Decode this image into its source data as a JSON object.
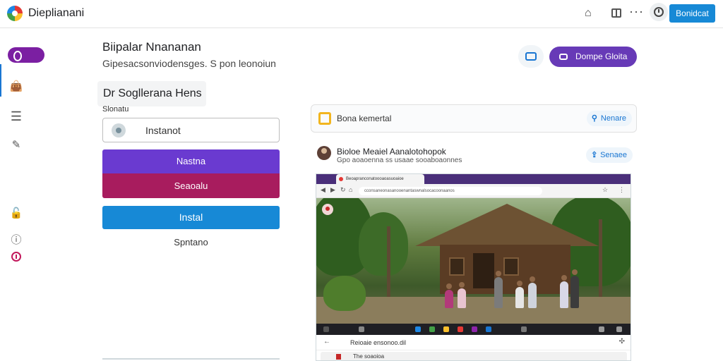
{
  "app": {
    "title": "Dieplianani"
  },
  "topbar": {
    "primary_label": "Bonidcat"
  },
  "header": {
    "title": "Biipalar Nnananan",
    "subtitle": "Gipesacsonviodensges. S pon leonoiun",
    "purple_button_label": "Dompe Gloita"
  },
  "form": {
    "section_heading": "Dr Sogllerana Hens",
    "field_label": "Slonatu",
    "field_value": "Instanot",
    "button_a_label": "Nastna",
    "button_b_label": "Seaoalu",
    "install_label": "Instal",
    "link_label": "Spntano"
  },
  "card1": {
    "label": "Bona kemertal",
    "button_label": "Nenare",
    "button_icon": "search-icon"
  },
  "post": {
    "title": "Bioloe Meaiel Aanalotohopok",
    "subtitle": "Gpo aoaoenna ss usaae sooaboaonnes",
    "button_label": "Senaee"
  },
  "browser": {
    "tab_title": "Beoapranconatoooaoasuoaioe",
    "url": "cconsaneonasanooenantaswnalsocacoonaanos",
    "lower_label": "Reioaie ensonoo.dil",
    "row_label": "The soaoioa"
  },
  "colors": {
    "accent_blue": "#1789d6",
    "purple": "#673ab7",
    "button_purple": "#6a3ad0",
    "button_magenta": "#a81c5e",
    "rail_pill": "#7b1fa2"
  }
}
